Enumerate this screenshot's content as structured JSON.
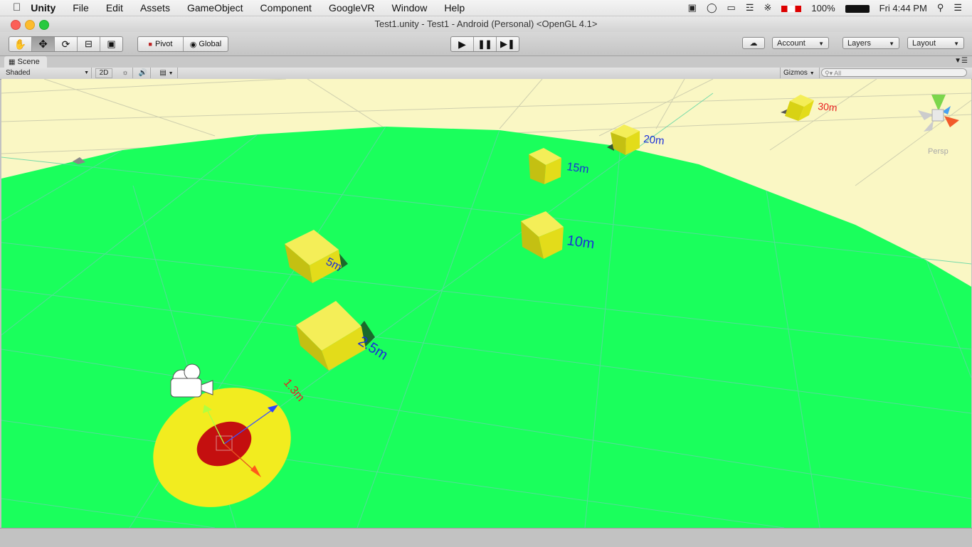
{
  "menubar": {
    "app": "Unity",
    "items": [
      "File",
      "Edit",
      "Assets",
      "GameObject",
      "Component",
      "GoogleVR",
      "Window",
      "Help"
    ],
    "battery": "100%",
    "clock": "Fri 4:44 PM"
  },
  "window": {
    "title": "Test1.unity - Test1 - Android (Personal) <OpenGL 4.1>"
  },
  "toolbar": {
    "pivot_label": "Pivot",
    "global_label": "Global",
    "account_label": "Account",
    "layers_label": "Layers",
    "layout_label": "Layout"
  },
  "scene": {
    "tab_label": "Scene",
    "shading_mode": "Shaded",
    "mode_2d_label": "2D",
    "gizmos_label": "Gizmos",
    "search_placeholder": "All",
    "projection_label": "Persp",
    "distance_labels": [
      "1.3m",
      "2.5m",
      "5m",
      "10m",
      "15m",
      "20m",
      "30m"
    ]
  },
  "colors": {
    "ground": "#1aff5c",
    "cube": "#e8e21a",
    "label_blue": "#1b2fd8",
    "label_red": "#e81f1f",
    "target_outer": "#f2ec1f",
    "target_inner": "#c40f0f"
  }
}
